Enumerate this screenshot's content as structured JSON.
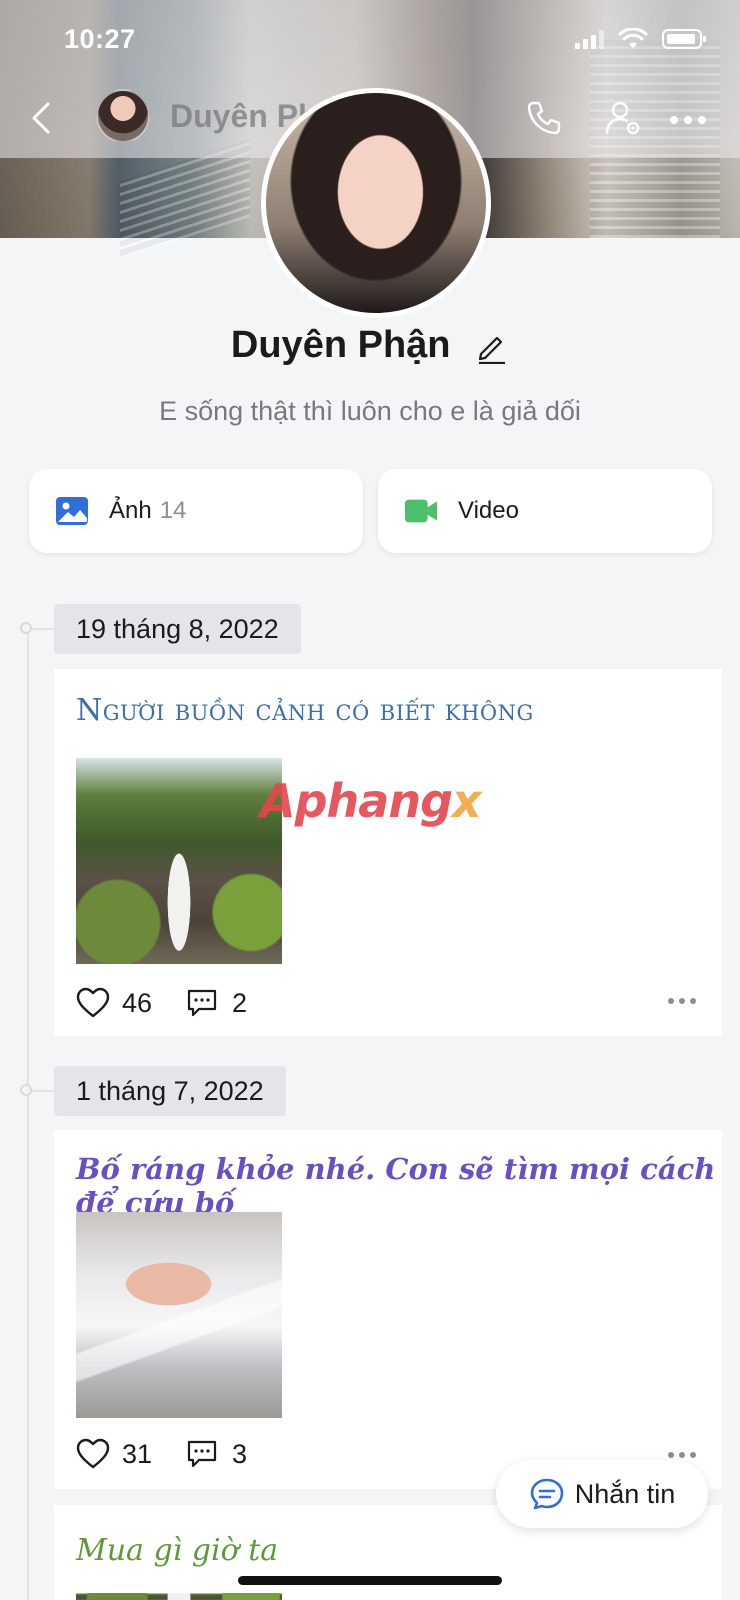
{
  "status_bar": {
    "time": "10:27"
  },
  "header": {
    "name": "Duyên Phận"
  },
  "profile": {
    "name": "Duyên Phận",
    "bio": "E sống thật thì luôn cho e là giả dối"
  },
  "media": {
    "photos_label": "Ảnh",
    "photos_count": "14",
    "video_label": "Video"
  },
  "posts": [
    {
      "date": "19 tháng 8, 2022",
      "caption": "Người buồn cảnh có biết không",
      "caption_color": "#3b6fa8",
      "likes": "46",
      "comments": "2"
    },
    {
      "date": "1 tháng 7, 2022",
      "caption": "Bố ráng khỏe nhé. Con sẽ tìm mọi cách để cứu bố",
      "caption_color": "#6a4fc4",
      "likes": "31",
      "comments": "3"
    },
    {
      "caption": "Mua gì giờ ta",
      "caption_color": "#5f9a3a"
    }
  ],
  "watermark": {
    "text": "Aphang",
    "suffix": "x"
  },
  "fab": {
    "label": "Nhắn tin"
  },
  "colors": {
    "accent_blue": "#2f6fd6",
    "video_green": "#4cbf6b"
  }
}
